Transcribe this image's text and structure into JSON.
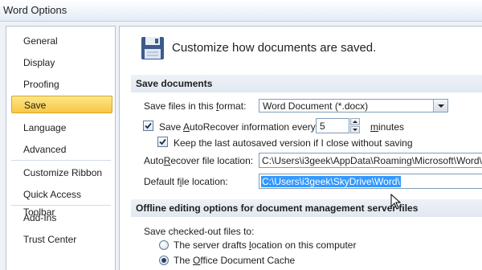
{
  "window": {
    "title": "Word Options"
  },
  "sidebar": {
    "items": [
      {
        "label": "General"
      },
      {
        "label": "Display"
      },
      {
        "label": "Proofing"
      },
      {
        "label": "Save",
        "selected": true
      },
      {
        "label": "Language"
      },
      {
        "label": "Advanced"
      },
      {
        "label": "Customize Ribbon"
      },
      {
        "label": "Quick Access Toolbar"
      },
      {
        "label": "Add-Ins"
      },
      {
        "label": "Trust Center"
      }
    ]
  },
  "main": {
    "heading": "Customize how documents are saved.",
    "heading_icon": "floppy-disk-icon",
    "save_section": {
      "title": "Save documents",
      "format_label_pre": "Save files in this ",
      "format_label_u": "f",
      "format_label_post": "ormat:",
      "format_value": "Word Document (*.docx)",
      "autorecover_pre": "Save ",
      "autorecover_u": "A",
      "autorecover_post": "utoRecover information every",
      "autorecover_checked": true,
      "autorecover_minutes": "5",
      "minutes_label_u": "m",
      "minutes_label_post": "inutes",
      "keep_last_label": "Keep the last autosaved version if I close without saving",
      "keep_last_checked": true,
      "ar_location_pre": "Auto",
      "ar_location_u": "R",
      "ar_location_post": "ecover file location:",
      "ar_location_value": "C:\\Users\\i3geek\\AppData\\Roaming\\Microsoft\\Word\\",
      "default_location_pre": "Default f",
      "default_location_u": "i",
      "default_location_post": "le location:",
      "default_location_value": "C:\\Users\\i3geek\\SkyDrive\\Word\\"
    },
    "offline_section": {
      "title": "Offline editing options for document management server files",
      "checked_out_pre": "Save checked-out files to:",
      "checked_out_u": "",
      "radio_server_pre": "The server drafts ",
      "radio_server_u": "l",
      "radio_server_post": "ocation on this computer",
      "radio_cache_pre": "The ",
      "radio_cache_u": "O",
      "radio_cache_post": "ffice Document Cache",
      "selected_option": "office-document-cache"
    }
  },
  "colors": {
    "selected_nav": "#f8c743",
    "selection_highlight": "#3399ff"
  }
}
